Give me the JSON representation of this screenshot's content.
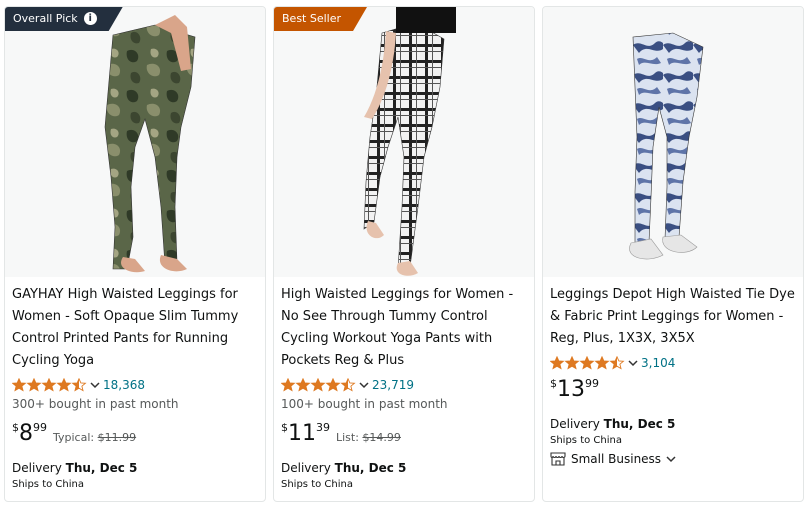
{
  "products": [
    {
      "badge": {
        "text": "Overall Pick",
        "has_info": true,
        "color": "#232f3e"
      },
      "title": "GAYHAY High Waisted Leggings for Women - Soft Opaque Slim Tummy Control Printed Pants for Running Cycling Yoga",
      "rating": 4.5,
      "rating_count": "18,368",
      "bought": "300+ bought in past month",
      "price": {
        "symbol": "$",
        "whole": "8",
        "fraction": "99"
      },
      "typical": {
        "label": "Typical:",
        "value": "$11.99"
      },
      "delivery": {
        "prefix": "Delivery",
        "date": "Thu, Dec 5"
      },
      "ships": "Ships to China",
      "image_icon": "camouflage-leggings-image"
    },
    {
      "badge": {
        "text": "Best Seller",
        "has_info": false,
        "color": "#c45500"
      },
      "title": "High Waisted Leggings for Women - No See Through Tummy Control Cycling Workout Yoga Pants with Pockets Reg & Plus",
      "rating": 4.5,
      "rating_count": "23,719",
      "bought": "100+ bought in past month",
      "price": {
        "symbol": "$",
        "whole": "11",
        "fraction": "39"
      },
      "typical": {
        "label": "List:",
        "value": "$14.99"
      },
      "delivery": {
        "prefix": "Delivery",
        "date": "Thu, Dec 5"
      },
      "ships": "Ships to China",
      "image_icon": "plaid-leggings-image"
    },
    {
      "badge": null,
      "title": "Leggings Depot High Waisted Tie Dye & Fabric Print Leggings for Women - Reg, Plus, 1X3X, 3X5X",
      "rating": 4.5,
      "rating_count": "3,104",
      "bought": "",
      "price": {
        "symbol": "$",
        "whole": "13",
        "fraction": "99"
      },
      "typical": null,
      "delivery": {
        "prefix": "Delivery",
        "date": "Thu, Dec 5"
      },
      "ships": "Ships to China",
      "small_business": "Small Business",
      "image_icon": "tie-dye-leggings-image"
    }
  ],
  "colors": {
    "star": "#de7921",
    "link": "#007185",
    "muted": "#565959",
    "card_border": "#e3e6e6"
  }
}
